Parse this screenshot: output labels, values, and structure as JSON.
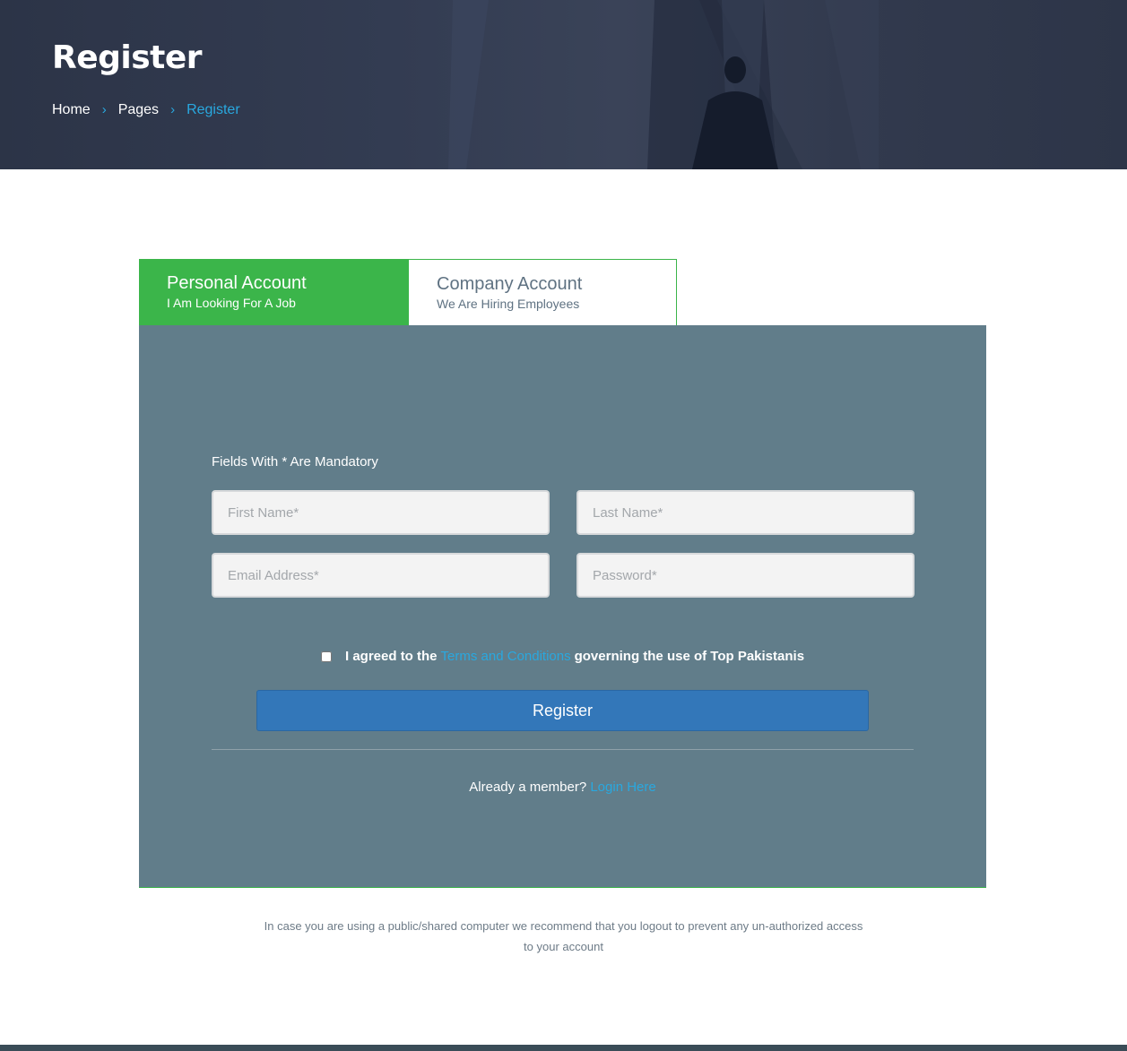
{
  "header": {
    "title": "Register",
    "breadcrumb": [
      {
        "label": "Home"
      },
      {
        "label": "Pages"
      },
      {
        "label": "Register"
      }
    ],
    "separator_icon": "chevron-right-icon"
  },
  "tabs": {
    "personal": {
      "title": "Personal Account",
      "subtitle": "I Am Looking For A Job",
      "active": true
    },
    "company": {
      "title": "Company Account",
      "subtitle": "We Are Hiring Employees",
      "active": false
    }
  },
  "form": {
    "mandatory_note": "Fields With * Are Mandatory",
    "fields": {
      "first_name": {
        "placeholder": "First Name*",
        "value": ""
      },
      "last_name": {
        "placeholder": "Last Name*",
        "value": ""
      },
      "email": {
        "placeholder": "Email Address*",
        "value": ""
      },
      "password": {
        "placeholder": "Password*",
        "value": ""
      }
    },
    "agreement": {
      "checked": false,
      "prefix": "I agreed to the",
      "link": "Terms and Conditions",
      "suffix": "governing the use of Top Pakistanis"
    },
    "submit_label": "Register",
    "member_prompt": "Already a member?",
    "login_link": "Login Here"
  },
  "notice": "In case you are using a public/shared computer we recommend that you logout to prevent any un-authorized access to your account",
  "colors": {
    "active_tab": "#3bb54a",
    "panel": "#617d8a",
    "button": "#3377b9",
    "link": "#29a8df",
    "hero": "#2f384c"
  }
}
